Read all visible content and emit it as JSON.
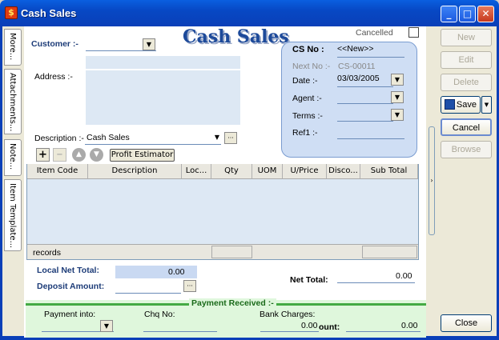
{
  "window": {
    "title": "Cash Sales",
    "icon": "cash-register-icon"
  },
  "side_tabs": [
    "More...",
    "Attachments...",
    "Note...",
    "Item Template..."
  ],
  "header": {
    "big_title": "Cash Sales",
    "cancelled_label": "Cancelled"
  },
  "form": {
    "customer_label": "Customer :-",
    "address_label": "Address :-",
    "description_label": "Description :-",
    "description_value": "Cash Sales",
    "profit_estimator": "Profit Estimator"
  },
  "cs_panel": {
    "cs_no_label": "CS No :",
    "cs_no_value": "<<New>>",
    "next_no_label": "Next No :-",
    "next_no_value": "CS-00011",
    "date_label": "Date :-",
    "date_value": "03/03/2005",
    "agent_label": "Agent :-",
    "terms_label": "Terms :-",
    "ref1_label": "Ref1 :-"
  },
  "grid": {
    "columns": [
      "Item Code",
      "Description",
      "Loc...",
      "Qty",
      "UOM",
      "U/Price",
      "Disco...",
      "Sub Total"
    ],
    "footer": "records"
  },
  "totals": {
    "local_net_total_label": "Local Net Total:",
    "local_net_total_value": "0.00",
    "deposit_label": "Deposit Amount:",
    "net_total_label": "Net Total:",
    "net_total_value": "0.00"
  },
  "payment": {
    "header": "Payment Received :-",
    "payment_into_label": "Payment into:",
    "chq_label": "Chq No:",
    "bank_charges_label": "Bank Charges:",
    "bank_charges_value": "0.00",
    "amount_label": "ount:",
    "amount_value": "0.00"
  },
  "buttons": {
    "new": "New",
    "edit": "Edit",
    "delete": "Delete",
    "save": "Save",
    "cancel": "Cancel",
    "browse": "Browse",
    "close": "Close"
  }
}
